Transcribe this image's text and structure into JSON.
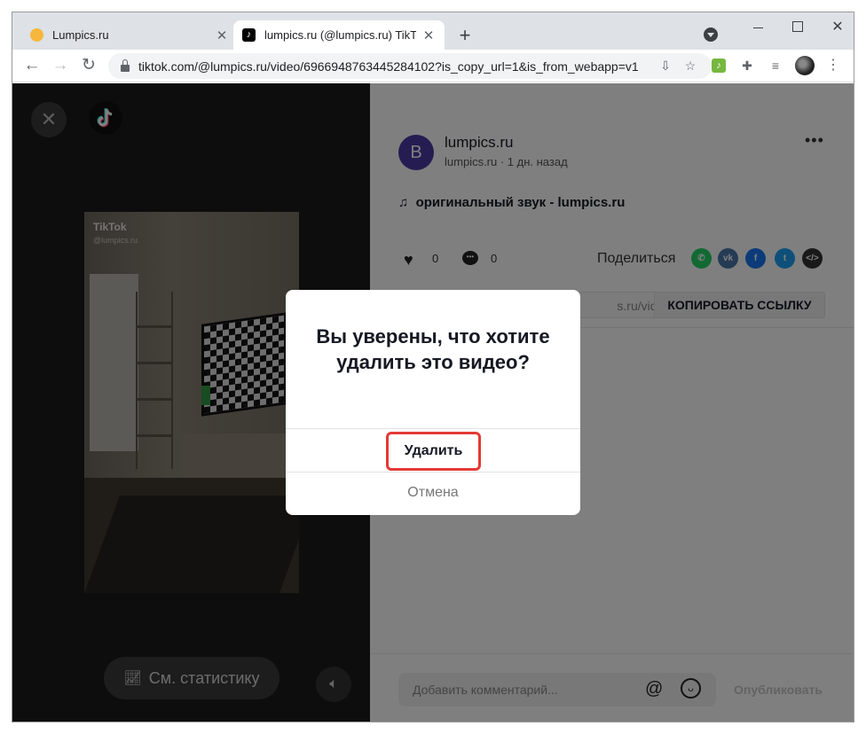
{
  "browser": {
    "tabs": [
      {
        "title": "Lumpics.ru",
        "close": "✕"
      },
      {
        "title": "lumpics.ru (@lumpics.ru) TikTok",
        "close": "✕"
      }
    ],
    "new_tab": "+",
    "address": "tiktok.com/@lumpics.ru/video/6966948763445284102?is_copy_url=1&is_from_webapp=v1"
  },
  "video": {
    "watermark": "TikTok",
    "handle": "@lumpics.ru",
    "stats_label": "См. статистику"
  },
  "post": {
    "avatar_letter": "B",
    "author_name": "lumpics.ru",
    "author_sub": "lumpics.ru · 1 дн. назад",
    "sound": "оригинальный звук - lumpics.ru",
    "likes": "0",
    "comments": "0",
    "share_label": "Поделиться",
    "link_text": "s.ru/vide...",
    "copy_link_label": "КОПИРОВАТЬ ССЫЛКУ",
    "comment_placeholder": "Добавить комментарий...",
    "post_label": "Опубликовать"
  },
  "dialog": {
    "title": "Вы уверены, что хотите удалить это видео?",
    "delete_label": "Удалить",
    "cancel_label": "Отмена",
    "highlight_color": "#e53935"
  },
  "colors": {
    "whatsapp": "#25d366",
    "vk": "#4a76a8",
    "facebook": "#1877f2",
    "twitter": "#1da1f2"
  }
}
